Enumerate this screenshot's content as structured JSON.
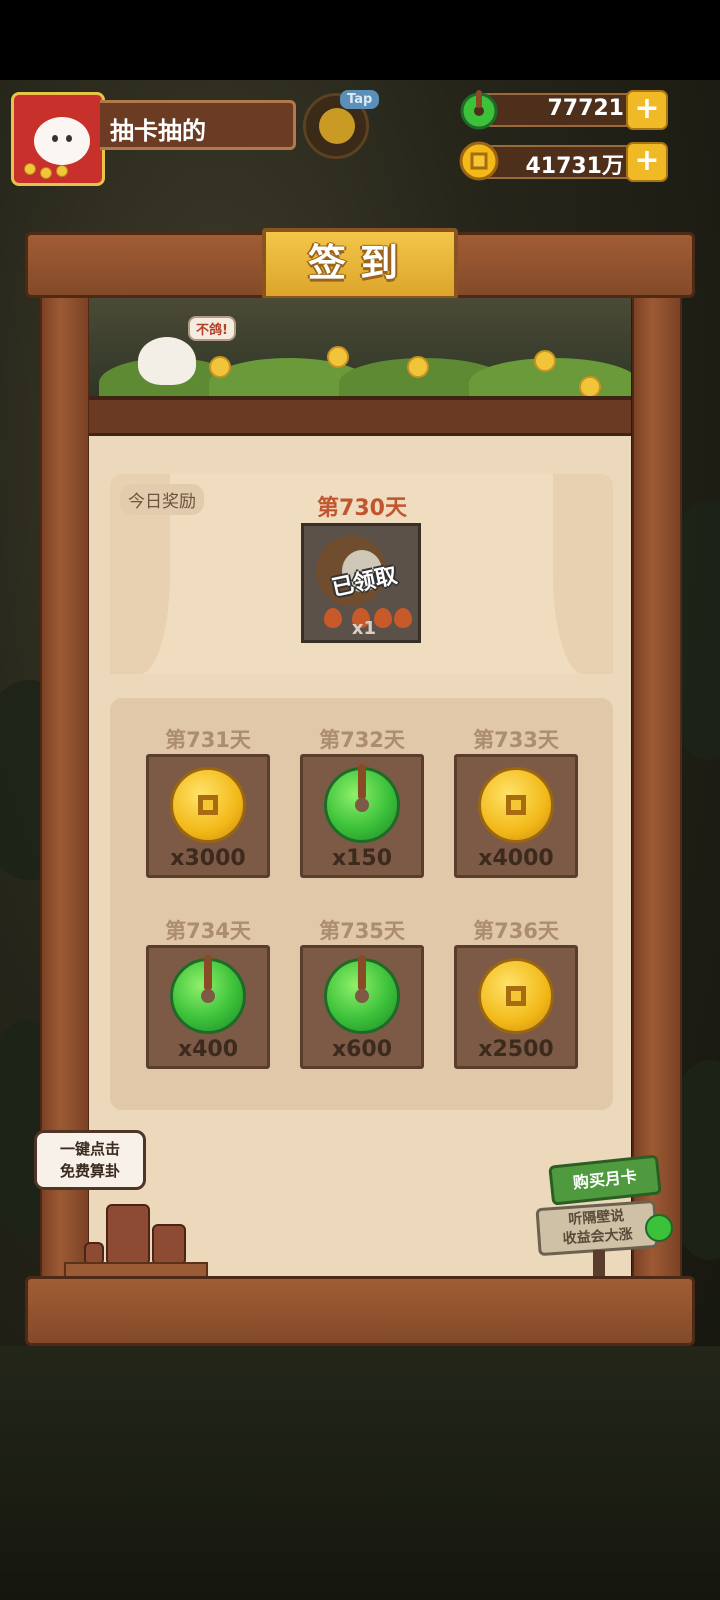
{
  "player": {
    "name": "抽卡抽的"
  },
  "tap_label": "Tap",
  "resources": {
    "jade": {
      "value": "77721",
      "icon": "jade-icon",
      "color": "#3cc13a"
    },
    "coins": {
      "value": "41731万",
      "icon": "coin-icon",
      "color": "#f2b918"
    }
  },
  "title": "签到",
  "chicken_bubble": "不鸽!",
  "today": {
    "tag": "今日奖励",
    "day_label": "第730天",
    "status": "已领取",
    "quantity": "x1"
  },
  "days": [
    {
      "label": "第731天",
      "reward": "coin",
      "quantity": "x3000"
    },
    {
      "label": "第732天",
      "reward": "jade",
      "quantity": "x150"
    },
    {
      "label": "第733天",
      "reward": "coin",
      "quantity": "x4000"
    },
    {
      "label": "第734天",
      "reward": "jade",
      "quantity": "x400"
    },
    {
      "label": "第735天",
      "reward": "jade",
      "quantity": "x600"
    },
    {
      "label": "第736天",
      "reward": "coin",
      "quantity": "x2500"
    }
  ],
  "hint": {
    "line1": "一键点击",
    "line2": "免费算卦"
  },
  "monthly_card": {
    "title": "购买月卡",
    "line1": "听隔壁说",
    "line2": "收益会大涨"
  },
  "colors": {
    "frame_wood": "#9c5a33",
    "title_gold": "#f3c649",
    "panel": "#ecd8bb",
    "day_text": "#c0552f"
  }
}
